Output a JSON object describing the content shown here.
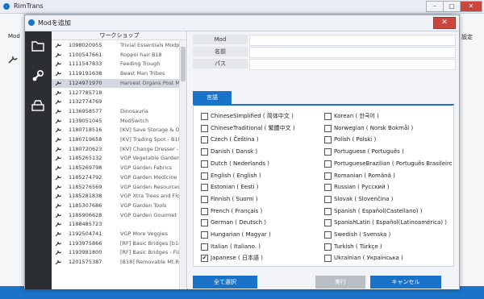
{
  "app": {
    "title": "RimTrans",
    "left_label": "Mod",
    "right_label": "設定"
  },
  "window_buttons": [
    "–",
    "□",
    "✕"
  ],
  "dialog": {
    "title": "Modを追加",
    "close": "✕"
  },
  "sidebar": {
    "icons": [
      "folder-icon",
      "steam-icon",
      "drive-icon"
    ]
  },
  "workshop": {
    "header": "ワークショップ",
    "items": [
      {
        "id": "1098020955",
        "name": "Trivial Essentials Modpack02"
      },
      {
        "id": "1100547661",
        "name": "Roppoi hair B18"
      },
      {
        "id": "1111547833",
        "name": "Feeding Trough"
      },
      {
        "id": "1119191638",
        "name": "Beast Man Tribes"
      },
      {
        "id": "1124971970",
        "name": "Harvest Organs Post Mortem"
      },
      {
        "id": "1127785718",
        "name": ""
      },
      {
        "id": "1132774769",
        "name": ""
      },
      {
        "id": "1136958577",
        "name": "Dinosauria"
      },
      {
        "id": "1139051045",
        "name": "ModSwitch"
      },
      {
        "id": "1180718516",
        "name": "[KV] Save Storage & Outfit"
      },
      {
        "id": "1180719658",
        "name": "[KV] Trading Spot - B18"
      },
      {
        "id": "1180720623",
        "name": "[KV] Change Dresser - B18"
      },
      {
        "id": "1185265132",
        "name": "VGP Vegetable Garden"
      },
      {
        "id": "1185269798",
        "name": "VGP Garden Fabrics"
      },
      {
        "id": "1185274792",
        "name": "VGP Garden Medicine"
      },
      {
        "id": "1185276569",
        "name": "VGP Garden Resources"
      },
      {
        "id": "1185281838",
        "name": "VGP Xtra Trees and Flowers"
      },
      {
        "id": "1185307686",
        "name": "VGP Garden Tools"
      },
      {
        "id": "1185906628",
        "name": "VGP Garden Gourmet"
      },
      {
        "id": "1188485723",
        "name": ""
      },
      {
        "id": "1192504741",
        "name": "VGP More Veggies"
      },
      {
        "id": "1193975866",
        "name": "[RF] Basic Bridges [b18]"
      },
      {
        "id": "1193981800",
        "name": "[RF] Basic Bridges - Fishing"
      },
      {
        "id": "1201575387",
        "name": "[B18] Removable Mt.Rock"
      }
    ],
    "selected_index": 4
  },
  "detail": {
    "mod_label": "Mod",
    "name_label": "名前",
    "path_label": "パス",
    "languages_tab": "言語"
  },
  "languages": {
    "left": [
      {
        "label": "ChineseSimplified ( 简体中文 )",
        "checked": false
      },
      {
        "label": "ChineseTraditional ( 繁體中文 )",
        "checked": false
      },
      {
        "label": "Czech ( Čeština )",
        "checked": false
      },
      {
        "label": "Danish ( Dansk )",
        "checked": false
      },
      {
        "label": "Dutch ( Nederlands )",
        "checked": false
      },
      {
        "label": "English ( English )",
        "checked": false
      },
      {
        "label": "Estonian ( Eesti )",
        "checked": false
      },
      {
        "label": "Finnish ( Suomi )",
        "checked": false
      },
      {
        "label": "French ( Français )",
        "checked": false
      },
      {
        "label": "German ( Deutsch )",
        "checked": false
      },
      {
        "label": "Hungarian ( Magyar )",
        "checked": false
      },
      {
        "label": "Italian ( Italiano. )",
        "checked": false
      },
      {
        "label": "Japanese ( 日本語 )",
        "checked": true
      }
    ],
    "right": [
      {
        "label": "Korean ( 한국어 )",
        "checked": false
      },
      {
        "label": "Norwegian ( Norsk Bokmål )",
        "checked": false
      },
      {
        "label": "Polish ( Polski )",
        "checked": false
      },
      {
        "label": "Portuguese ( Português )",
        "checked": false
      },
      {
        "label": "PortugueseBrazilian ( Português Brasileiro )",
        "checked": false
      },
      {
        "label": "Romanian ( Română )",
        "checked": false
      },
      {
        "label": "Russian ( Русский )",
        "checked": false
      },
      {
        "label": "Slovak ( Slovenčina )",
        "checked": false
      },
      {
        "label": "Spanish ( Español(Castellano) )",
        "checked": false
      },
      {
        "label": "SpanishLatin ( Español(Latinoamérica) )",
        "checked": false
      },
      {
        "label": "Swedish ( Svenska )",
        "checked": false
      },
      {
        "label": "Turkish ( Türkçe )",
        "checked": false
      },
      {
        "label": "Ukrainian ( Українська )",
        "checked": false
      }
    ],
    "check_mark": "✔"
  },
  "buttons": {
    "select_all": "全て選択",
    "execute": "実行",
    "cancel": "キャンセル"
  },
  "colors": {
    "accent": "#1a73c8",
    "sidebar": "#2b2e33",
    "disabled": "#b9bec5"
  }
}
